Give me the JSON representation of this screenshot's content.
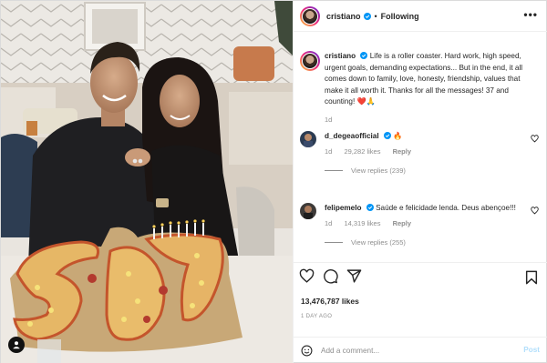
{
  "header": {
    "username": "cristiano",
    "separator": "•",
    "follow_status": "Following",
    "more_glyph": "•••"
  },
  "caption": {
    "username": "cristiano",
    "text": "Life is a roller coaster. Hard work, high speed, urgent goals, demanding expectations... But in the end, it all comes down to family, love, honesty, friendship, values that make it all worth it. Thanks for all the messages! 37 and counting! ❤️🙏",
    "time": "1d"
  },
  "comments": [
    {
      "username": "d_degeaofficial",
      "text": "🔥",
      "time": "1d",
      "likes": "29,282 likes",
      "reply_label": "Reply",
      "view_replies": "View replies (239)"
    },
    {
      "username": "felipemelo",
      "text": "Saúde e felicidade lenda. Deus abençoe!!!",
      "time": "1d",
      "likes": "14,319 likes",
      "reply_label": "Reply",
      "view_replies": "View replies (255)"
    }
  ],
  "actions": {
    "icons": [
      "heart-icon",
      "comment-icon",
      "share-icon",
      "bookmark-icon"
    ],
    "likes": "13,476,787 likes",
    "time_ago": "1 DAY AGO"
  },
  "add_comment": {
    "placeholder": "Add a comment...",
    "post_label": "Post"
  },
  "colors": {
    "verified": "#0095f6",
    "post_button": "#b2dffc",
    "meta": "#8e8e8e"
  }
}
